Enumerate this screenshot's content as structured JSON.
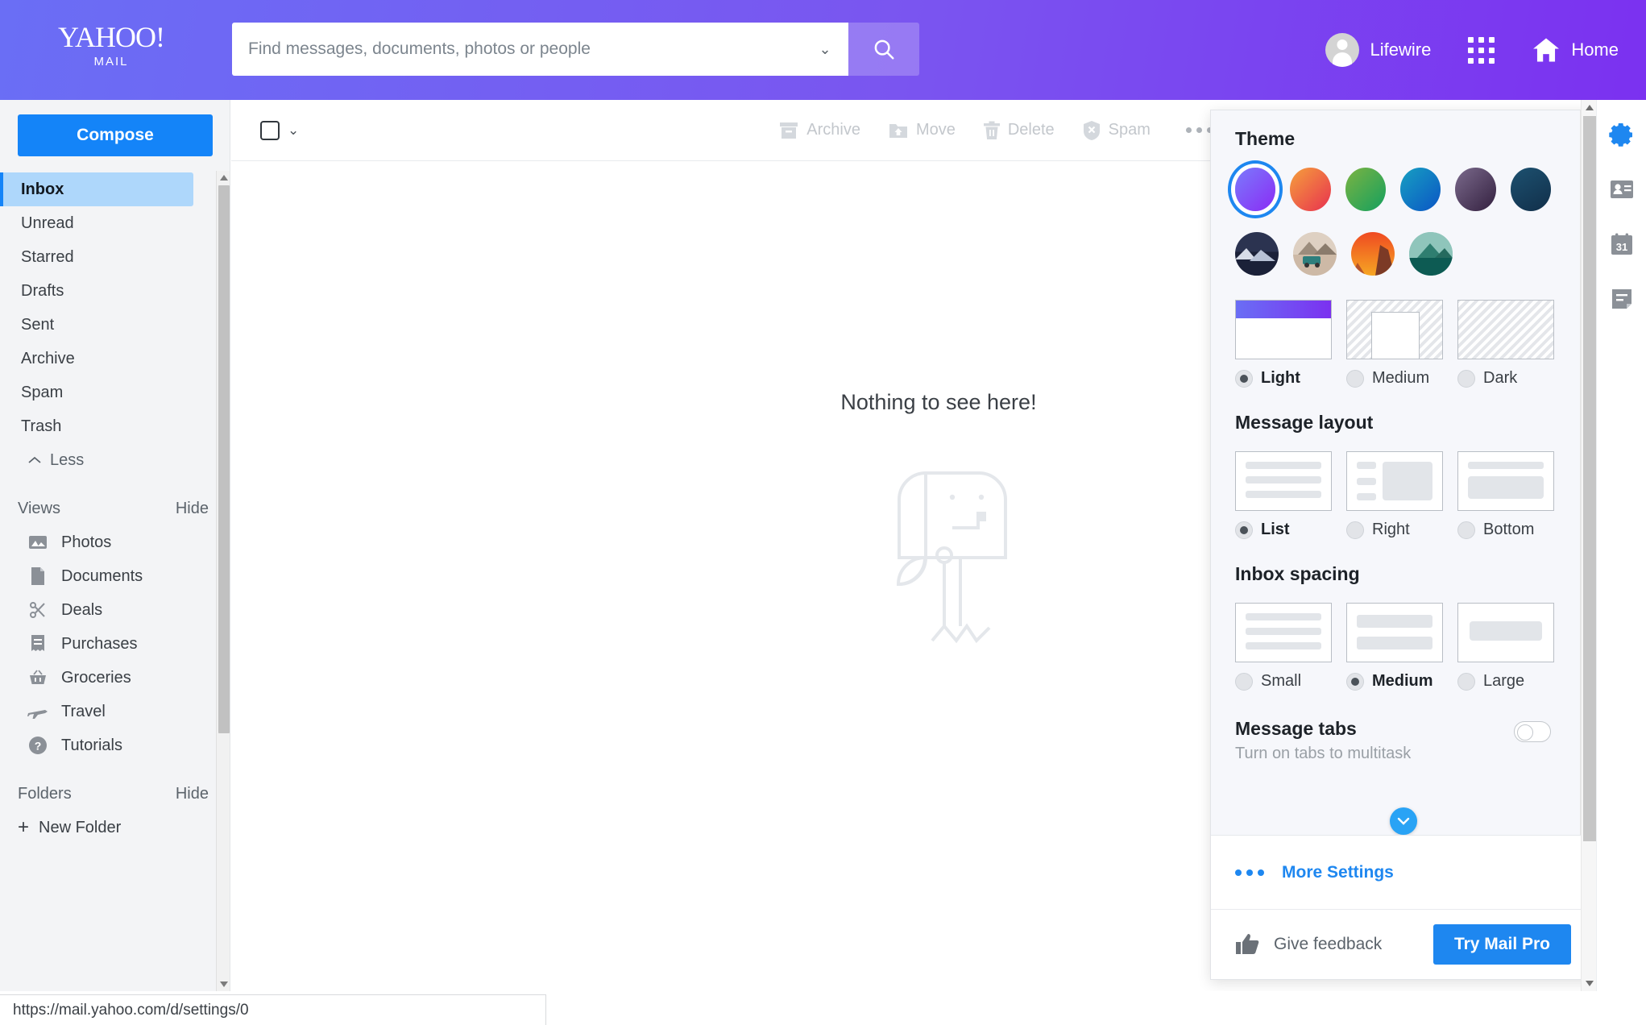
{
  "header": {
    "logo_main": "YAHOO!",
    "logo_sub": "MAIL",
    "search_placeholder": "Find messages, documents, photos or people",
    "search_value": "",
    "search_icon": "search-icon",
    "caret_icon": "chevron-down-icon",
    "user_name": "Lifewire",
    "apps_icon": "grid-apps-icon",
    "home_label": "Home",
    "home_icon": "home-icon"
  },
  "sidebar": {
    "compose_label": "Compose",
    "folders": [
      {
        "label": "Inbox",
        "active": true
      },
      {
        "label": "Unread",
        "active": false
      },
      {
        "label": "Starred",
        "active": false
      },
      {
        "label": "Drafts",
        "active": false
      },
      {
        "label": "Sent",
        "active": false
      },
      {
        "label": "Archive",
        "active": false
      },
      {
        "label": "Spam",
        "active": false
      },
      {
        "label": "Trash",
        "active": false
      }
    ],
    "less_label": "Less",
    "views_title": "Views",
    "views_hide": "Hide",
    "views": [
      {
        "label": "Photos",
        "icon": "photos-icon"
      },
      {
        "label": "Documents",
        "icon": "document-icon"
      },
      {
        "label": "Deals",
        "icon": "scissors-icon"
      },
      {
        "label": "Purchases",
        "icon": "receipt-icon"
      },
      {
        "label": "Groceries",
        "icon": "basket-icon"
      },
      {
        "label": "Travel",
        "icon": "airplane-icon"
      },
      {
        "label": "Tutorials",
        "icon": "question-circle-icon"
      }
    ],
    "folders_title": "Folders",
    "folders_hide": "Hide",
    "new_folder_label": "New Folder"
  },
  "toolbar": {
    "select_all_icon": "checkbox-icon",
    "select_caret_icon": "chevron-down-icon",
    "actions": [
      {
        "label": "Archive",
        "icon": "archive-icon"
      },
      {
        "label": "Move",
        "icon": "move-folder-icon"
      },
      {
        "label": "Delete",
        "icon": "trash-icon"
      },
      {
        "label": "Spam",
        "icon": "spam-shield-icon"
      }
    ],
    "more_icon": "more-horizontal-icon"
  },
  "main": {
    "empty_text": "Nothing to see here!",
    "empty_illustration": "mailbox-illustration"
  },
  "settings": {
    "theme": {
      "title": "Theme",
      "color_swatches": [
        {
          "name": "purple-theme",
          "from": "#7b7bfb",
          "to": "#8a2bf5",
          "selected": true
        },
        {
          "name": "sunset-theme",
          "from": "#f5a03c",
          "to": "#e8314f",
          "selected": false
        },
        {
          "name": "green-theme",
          "from": "#7cb342",
          "to": "#14a05e",
          "selected": false
        },
        {
          "name": "blue-theme",
          "from": "#17a0c2",
          "to": "#0b55c4",
          "selected": false
        },
        {
          "name": "plum-theme",
          "from": "#7b6a8c",
          "to": "#33203f",
          "selected": false
        },
        {
          "name": "navy-theme",
          "from": "#1d5170",
          "to": "#112f4a",
          "selected": false
        }
      ],
      "photo_swatches": [
        {
          "name": "mountain-night-theme",
          "sky": "#2b3350",
          "land": "#1b2138",
          "snow": "#d7dce8"
        },
        {
          "name": "campervan-theme",
          "sky": "#e2d2c4",
          "land": "#cdb9a6",
          "snow": "#2d7f7d"
        },
        {
          "name": "canyon-sunset-theme",
          "sky": "#ef4a22",
          "land": "#f6a623",
          "snow": "#7c3a26"
        },
        {
          "name": "lake-theme",
          "sky": "#8fc5bb",
          "land": "#0d5b53",
          "snow": "#2f7e70"
        }
      ],
      "modes": [
        {
          "label": "Light",
          "selected": true,
          "name": "light-mode"
        },
        {
          "label": "Medium",
          "selected": false,
          "name": "medium-mode"
        },
        {
          "label": "Dark",
          "selected": false,
          "name": "dark-mode"
        }
      ]
    },
    "message_layout": {
      "title": "Message layout",
      "options": [
        {
          "label": "List",
          "selected": true,
          "name": "layout-list"
        },
        {
          "label": "Right",
          "selected": false,
          "name": "layout-right"
        },
        {
          "label": "Bottom",
          "selected": false,
          "name": "layout-bottom"
        }
      ]
    },
    "inbox_spacing": {
      "title": "Inbox spacing",
      "options": [
        {
          "label": "Small",
          "selected": false,
          "name": "spacing-small"
        },
        {
          "label": "Medium",
          "selected": true,
          "name": "spacing-medium"
        },
        {
          "label": "Large",
          "selected": false,
          "name": "spacing-large"
        }
      ]
    },
    "message_tabs": {
      "title": "Message tabs",
      "subtitle": "Turn on tabs to multitask",
      "enabled": false
    },
    "scroll_more_icon": "chevron-down-circle-icon",
    "more_settings_label": "More Settings",
    "feedback_label": "Give feedback",
    "feedback_icon": "thumbs-up-icon",
    "mail_pro_label": "Try Mail Pro"
  },
  "right_rail": [
    {
      "name": "gear-icon",
      "label": "Settings",
      "active": true
    },
    {
      "name": "contacts-icon",
      "label": "Contacts",
      "active": false
    },
    {
      "name": "calendar-icon",
      "label": "Calendar",
      "active": false
    },
    {
      "name": "notepad-icon",
      "label": "Notepad",
      "active": false
    }
  ],
  "status_bar": {
    "url": "https://mail.yahoo.com/d/settings/0"
  }
}
